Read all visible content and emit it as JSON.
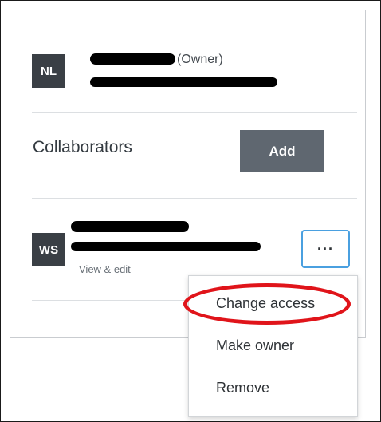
{
  "owner": {
    "initials": "NL",
    "role_tag": "(Owner)"
  },
  "collaborators_section": {
    "title": "Collaborators",
    "add_label": "Add"
  },
  "collaborator": {
    "initials": "WS",
    "permission": "View & edit",
    "more_label": "···"
  },
  "context_menu": {
    "items": [
      {
        "label": "Change access"
      },
      {
        "label": "Make owner"
      },
      {
        "label": "Remove"
      }
    ]
  },
  "colors": {
    "avatar_bg": "#3a3f45",
    "add_button_bg": "#5f6770",
    "focus_border": "#4aa0e0",
    "annotation_circle": "#e0141a"
  }
}
